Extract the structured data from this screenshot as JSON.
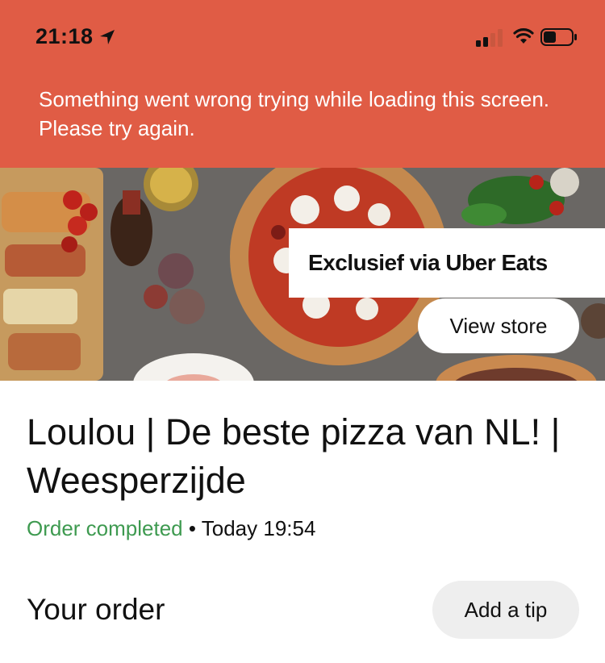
{
  "status_bar": {
    "time": "21:18",
    "icons": [
      "location-arrow-icon",
      "cellular-signal-icon",
      "wifi-icon",
      "battery-icon"
    ]
  },
  "error_banner": {
    "message": "Something went wrong trying while loading this screen. Please try again.",
    "background_color": "#e05c45"
  },
  "hero": {
    "promo_label": "Exclusief via Uber Eats",
    "view_store_label": "View store"
  },
  "store": {
    "title": "Loulou | De beste pizza van NL! | Weesperzijde"
  },
  "order": {
    "status": "Order completed",
    "status_color": "#3e9a50",
    "separator": "•",
    "time": "Today 19:54"
  },
  "section": {
    "title": "Your order",
    "tip_button_label": "Add a tip"
  }
}
